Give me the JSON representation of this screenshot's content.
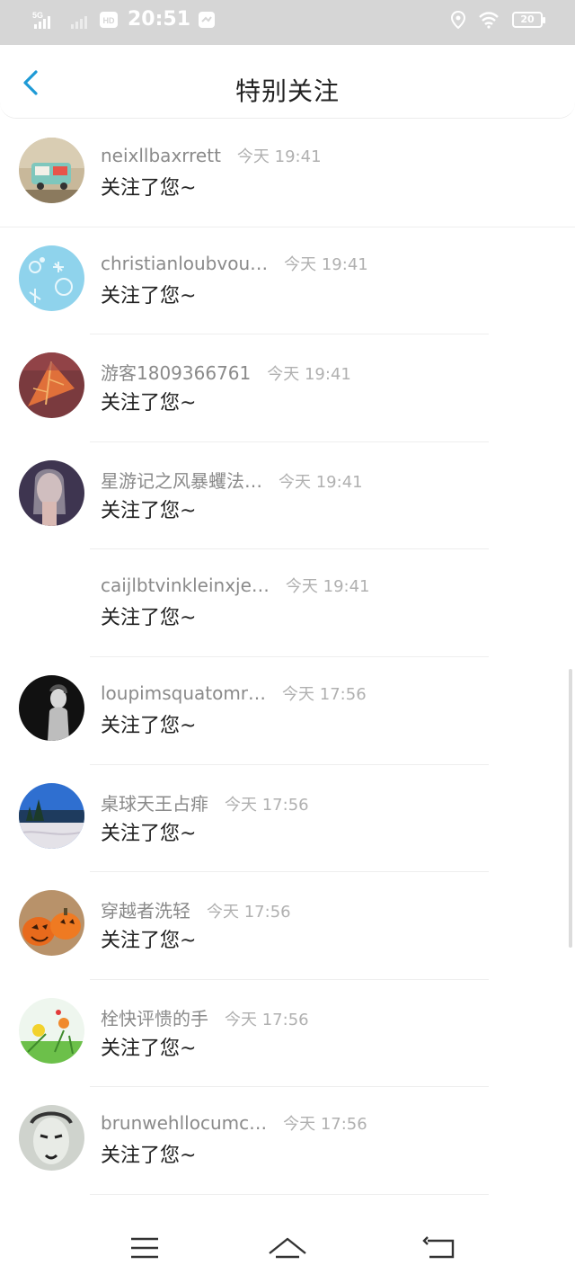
{
  "status_bar": {
    "network": "5G",
    "hd": "HD",
    "time": "20:51",
    "battery": "20"
  },
  "header": {
    "title": "特别关注"
  },
  "items": [
    {
      "username": "neixllbaxrrett",
      "time": "今天 19:41",
      "message": "关注了您~",
      "avatar": "avatar-food-truck"
    },
    {
      "username": "christianloubvou…",
      "time": "今天 19:41",
      "message": "关注了您~",
      "avatar": "avatar-blue-pattern"
    },
    {
      "username": "游客1809366761",
      "time": "今天 19:41",
      "message": "关注了您~",
      "avatar": "avatar-autumn-leaf"
    },
    {
      "username": "星游记之风暴蠼法…",
      "time": "今天 19:41",
      "message": "关注了您~",
      "avatar": "avatar-girl-portrait"
    },
    {
      "username": "caijlbtvinkleinxje…",
      "time": "今天 19:41",
      "message": "关注了您~",
      "avatar": ""
    },
    {
      "username": "loupimsquatomr…",
      "time": "今天 17:56",
      "message": "关注了您~",
      "avatar": "avatar-dark-portrait"
    },
    {
      "username": "桌球天王占痱",
      "time": "今天 17:56",
      "message": "关注了您~",
      "avatar": "avatar-snow-landscape"
    },
    {
      "username": "穿越者洗轻",
      "time": "今天 17:56",
      "message": "关注了您~",
      "avatar": "avatar-pumpkins"
    },
    {
      "username": "栓快评愦的手",
      "time": "今天 17:56",
      "message": "关注了您~",
      "avatar": "avatar-flowers"
    },
    {
      "username": "brunwehllocumc…",
      "time": "今天 17:56",
      "message": "关注了您~",
      "avatar": "avatar-face-art"
    }
  ],
  "nav": {
    "menu_icon": "menu-icon",
    "home_icon": "home-icon",
    "back_icon": "return-icon"
  },
  "colors": {
    "accent": "#1e9ad6",
    "status_bar": "#d6d6d6"
  }
}
